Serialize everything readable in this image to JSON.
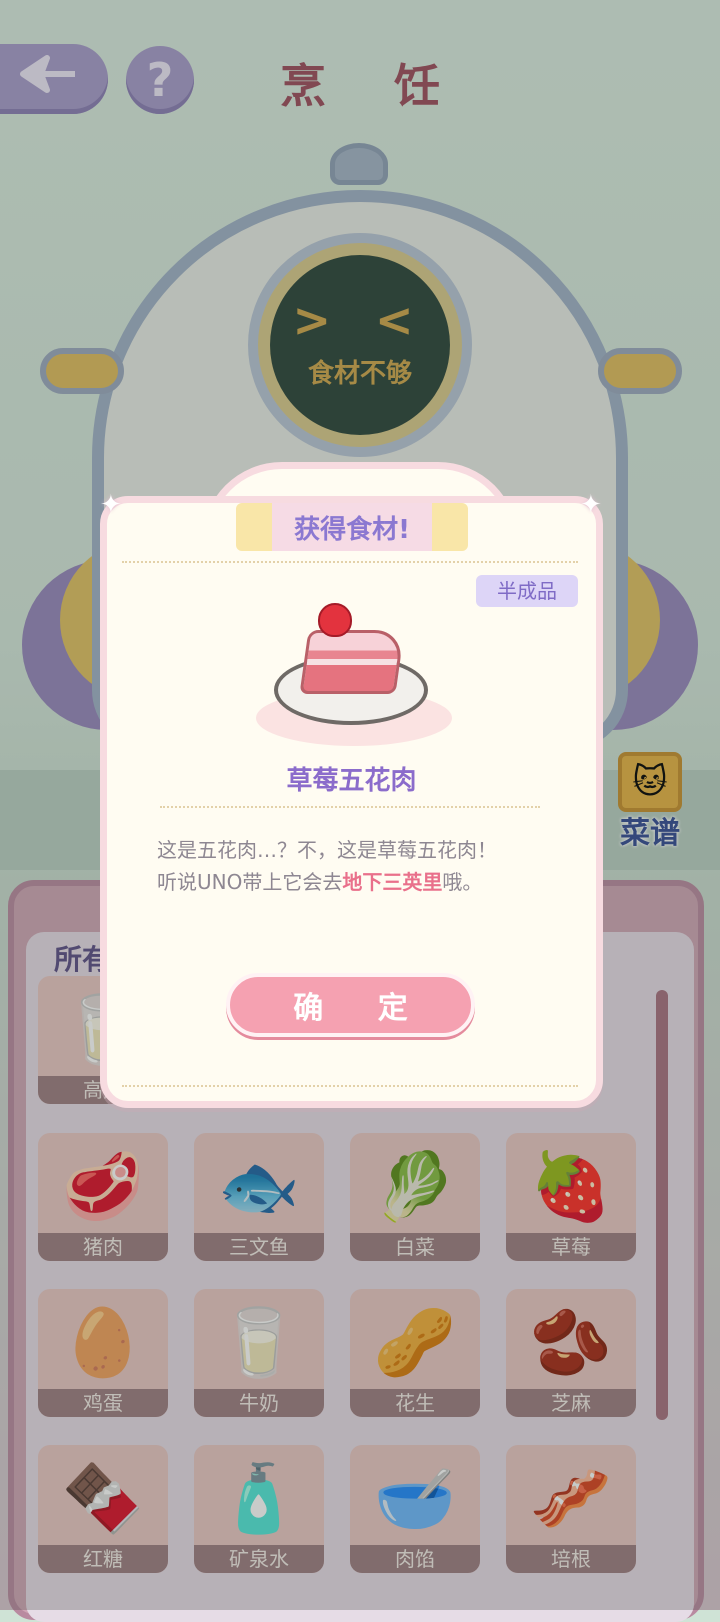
{
  "header": {
    "title": "烹 饪",
    "back_icon": "back-arrow-icon",
    "help_label": "?"
  },
  "machine": {
    "face": "> <",
    "status": "食材不够"
  },
  "recipe_button": {
    "label": "菜谱"
  },
  "inventory": {
    "tab_label": "所有",
    "rows": [
      [
        {
          "name": "高筋",
          "icon": "🥛"
        }
      ],
      [
        {
          "name": "猪肉",
          "icon": "🥩"
        },
        {
          "name": "三文鱼",
          "icon": "🐟"
        },
        {
          "name": "白菜",
          "icon": "🥬"
        },
        {
          "name": "草莓",
          "icon": "🍓"
        }
      ],
      [
        {
          "name": "鸡蛋",
          "icon": "🥚"
        },
        {
          "name": "牛奶",
          "icon": "🥛"
        },
        {
          "name": "花生",
          "icon": "🥜"
        },
        {
          "name": "芝麻",
          "icon": "🫘"
        }
      ],
      [
        {
          "name": "红糖",
          "icon": "🍫"
        },
        {
          "name": "矿泉水",
          "icon": "🧴"
        },
        {
          "name": "肉馅",
          "icon": "🥣"
        },
        {
          "name": "培根",
          "icon": "🥓"
        }
      ]
    ]
  },
  "modal": {
    "title": "获得食材!",
    "badge": "半成品",
    "item_name": "草莓五花肉",
    "description_line1": "这是五花肉…？不，这是草莓五花肉！",
    "description_line2_pre": "听说UNO带上它会去",
    "description_line2_hl": "地下三英里",
    "description_line2_post": "哦。",
    "confirm_label": "确 定"
  },
  "colors": {
    "accent_purple": "#8b78d1",
    "confirm_pink": "#f5a1b1",
    "highlight": "#e9708b"
  }
}
